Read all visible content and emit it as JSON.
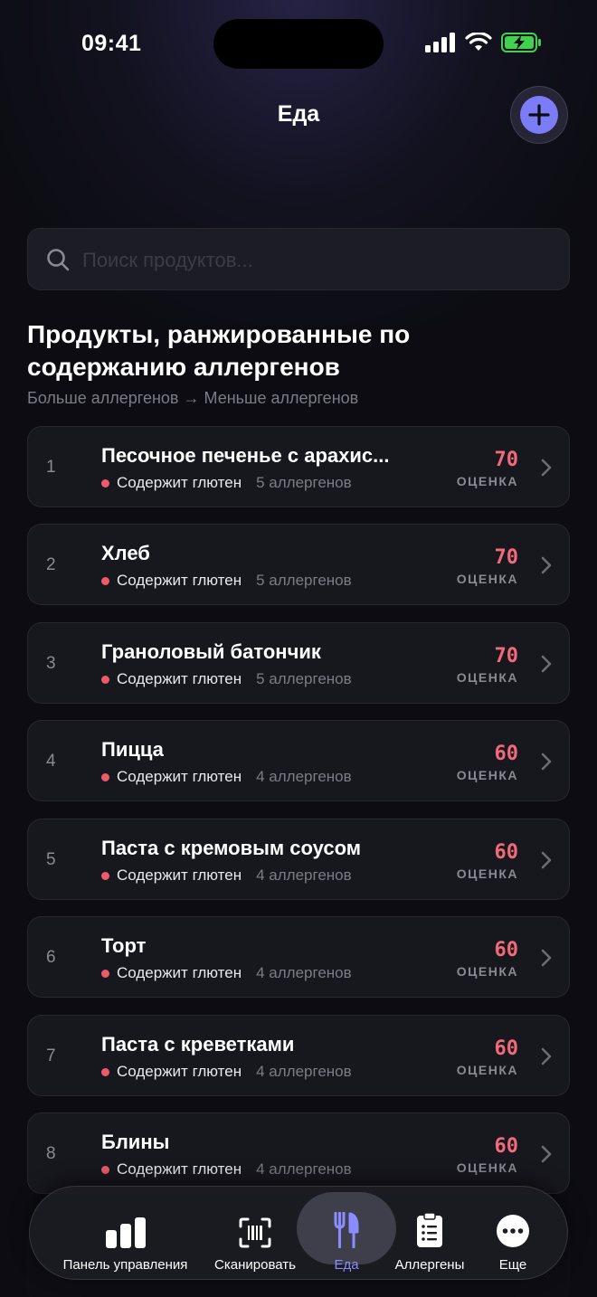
{
  "status_bar": {
    "time": "09:41"
  },
  "header": {
    "title": "Еда"
  },
  "search": {
    "placeholder": "Поиск продуктов..."
  },
  "section": {
    "title": "Продукты, ранжированные по содержанию аллергенов",
    "subtitle": "Больше аллергенов → Меньше аллергенов"
  },
  "colors": {
    "accent": "#7b7cf6",
    "score": "#f26a7a",
    "gluten_dot": "#ef5a6b"
  },
  "items": [
    {
      "rank": "1",
      "name": "Песочное печенье с арахис...",
      "tag": "Содержит глютен",
      "allergens": "5 аллергенов",
      "score": "70",
      "score_label": "ОЦЕНКА"
    },
    {
      "rank": "2",
      "name": "Хлеб",
      "tag": "Содержит глютен",
      "allergens": "5 аллергенов",
      "score": "70",
      "score_label": "ОЦЕНКА"
    },
    {
      "rank": "3",
      "name": "Граноловый батончик",
      "tag": "Содержит глютен",
      "allergens": "5 аллергенов",
      "score": "70",
      "score_label": "ОЦЕНКА"
    },
    {
      "rank": "4",
      "name": "Пицца",
      "tag": "Содержит глютен",
      "allergens": "4 аллергенов",
      "score": "60",
      "score_label": "ОЦЕНКА"
    },
    {
      "rank": "5",
      "name": "Паста с кремовым соусом",
      "tag": "Содержит глютен",
      "allergens": "4 аллергенов",
      "score": "60",
      "score_label": "ОЦЕНКА"
    },
    {
      "rank": "6",
      "name": "Торт",
      "tag": "Содержит глютен",
      "allergens": "4 аллергенов",
      "score": "60",
      "score_label": "ОЦЕНКА"
    },
    {
      "rank": "7",
      "name": "Паста с креветками",
      "tag": "Содержит глютен",
      "allergens": "4 аллергенов",
      "score": "60",
      "score_label": "ОЦЕНКА"
    },
    {
      "rank": "8",
      "name": "Блины",
      "tag": "Содержит глютен",
      "allergens": "4 аллергенов",
      "score": "60",
      "score_label": "ОЦЕНКА"
    }
  ],
  "tabbar": {
    "tabs": [
      {
        "label": "Панель управления",
        "icon": "bar-chart-icon"
      },
      {
        "label": "Сканировать",
        "icon": "barcode-scan-icon"
      },
      {
        "label": "Еда",
        "icon": "fork-knife-icon",
        "active": true
      },
      {
        "label": "Аллергены",
        "icon": "clipboard-list-icon"
      },
      {
        "label": "Еще",
        "icon": "more-icon"
      }
    ]
  }
}
